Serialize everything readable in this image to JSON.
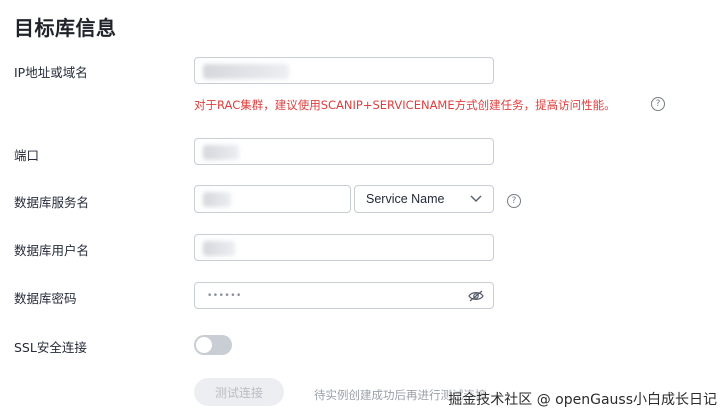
{
  "section_title": "目标库信息",
  "fields": {
    "host": {
      "label": "IP地址或域名",
      "tip": "对于RAC集群，建议使用SCANIP+SERVICENAME方式创建任务，提高访问性能。"
    },
    "port": {
      "label": "端口"
    },
    "service": {
      "label": "数据库服务名",
      "type_selected": "Service Name"
    },
    "user": {
      "label": "数据库用户名"
    },
    "password": {
      "label": "数据库密码",
      "mask": "••••••"
    },
    "ssl": {
      "label": "SSL安全连接",
      "enabled": false
    }
  },
  "actions": {
    "test_button": "测试连接",
    "hint": "待实例创建成功后再进行测试连接"
  },
  "watermark": "掘金技术社区 @ openGauss小白成长日记",
  "colors": {
    "tip_red": "#e03e3e",
    "toggle_off": "#c9cdd4"
  }
}
